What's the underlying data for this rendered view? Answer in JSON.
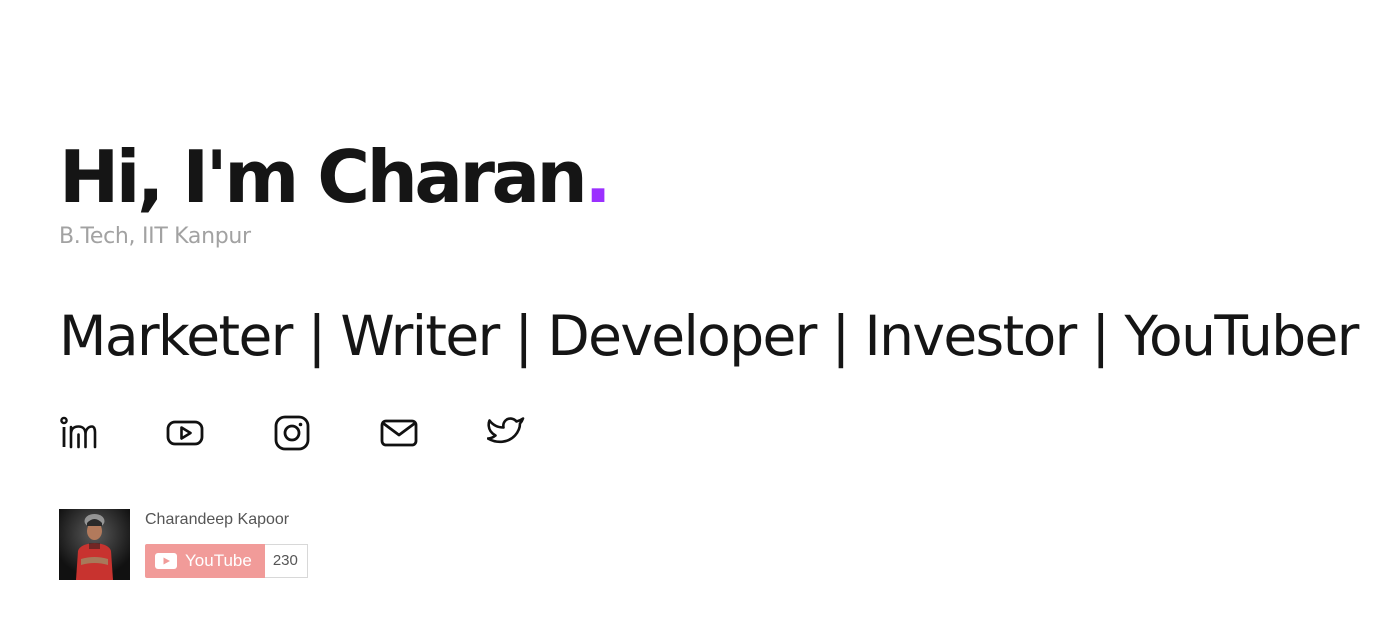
{
  "hero": {
    "greeting": "Hi, I'm Charan",
    "greeting_dot": ".",
    "subtitle": "B.Tech, IIT Kanpur",
    "roles": "Marketer | Writer | Developer | Investor | YouTuber"
  },
  "socials": [
    {
      "name": "linkedin",
      "icon": "linkedin-icon"
    },
    {
      "name": "youtube",
      "icon": "youtube-icon"
    },
    {
      "name": "instagram",
      "icon": "instagram-icon"
    },
    {
      "name": "email",
      "icon": "mail-icon"
    },
    {
      "name": "twitter",
      "icon": "twitter-icon"
    }
  ],
  "youtube_widget": {
    "channel_name": "Charandeep Kapoor",
    "button_label": "YouTube",
    "subscriber_count": "230"
  },
  "colors": {
    "accent": "#9b30ff",
    "youtube_button": "#f19b99",
    "text": "#151515",
    "muted": "#a2a2a2"
  }
}
